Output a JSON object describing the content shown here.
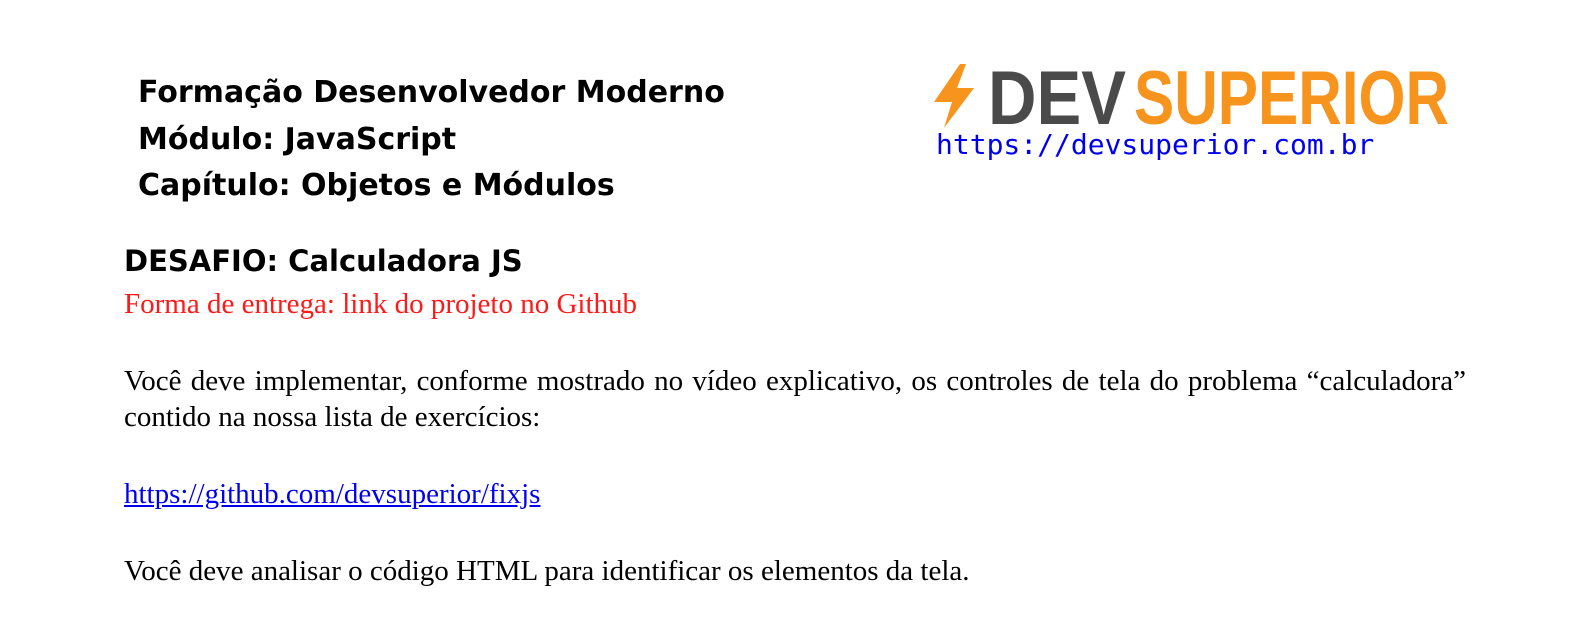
{
  "header": {
    "lines": [
      "Formação Desenvolvedor Moderno",
      "Módulo: JavaScript",
      "Capítulo: Objetos e Módulos"
    ]
  },
  "logo": {
    "brand_dev": "DEV",
    "brand_superior": "SUPERIOR",
    "url": "https://devsuperior.com.br",
    "colors": {
      "dark": "#4a4a4a",
      "orange": "#f7941d"
    }
  },
  "challenge": {
    "title": "DESAFIO: Calculadora JS",
    "delivery": "Forma de entrega: link do projeto no Github",
    "paragraph1": "Você deve implementar, conforme mostrado no vídeo explicativo, os controles de tela do problema “calculadora” contido na nossa lista de exercícios:",
    "link": "https://github.com/devsuperior/fixjs",
    "paragraph2": "Você deve analisar o código HTML para identificar os elementos da tela."
  }
}
